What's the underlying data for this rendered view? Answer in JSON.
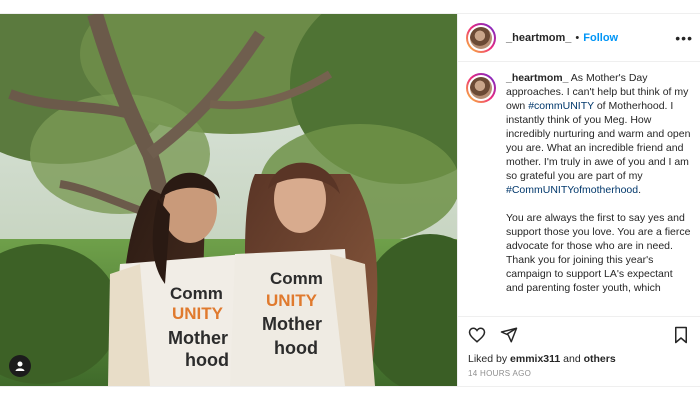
{
  "post": {
    "username": "_heartmom_",
    "separator": "•",
    "follow_label": "Follow",
    "more_icon": "more-horizontal-icon",
    "caption": {
      "username": "_heartmom_",
      "p1_a": " As Mother's Day approaches. I can't help but think of my own ",
      "p1_hashtag1": "#commUNITY",
      "p1_b": " of Motherhood. I instantly think of you Meg. How incredibly nurturing and warm and open you are. What an incredible friend and mother. I'm truly in awe of you and I am so grateful you are part of my ",
      "p1_hashtag2": "#CommUNITYofmotherhood",
      "p1_c": ".",
      "p2": "You are always the first to say yes and support those you love. You are a fierce advocate for those who are in need. Thank you for joining this year's campaign to support LA's expectant and parenting foster youth, which"
    },
    "shirt_text": [
      "Comm",
      "UNITY",
      "Mother",
      "hood"
    ],
    "likes_prefix": "Liked by ",
    "liked_by_user": "emmix311",
    "likes_and": " and ",
    "likes_others": "others",
    "timestamp": "14 HOURS AGO",
    "icons": [
      "heart-icon",
      "share-icon",
      "bookmark-icon",
      "tag-user-icon"
    ]
  }
}
